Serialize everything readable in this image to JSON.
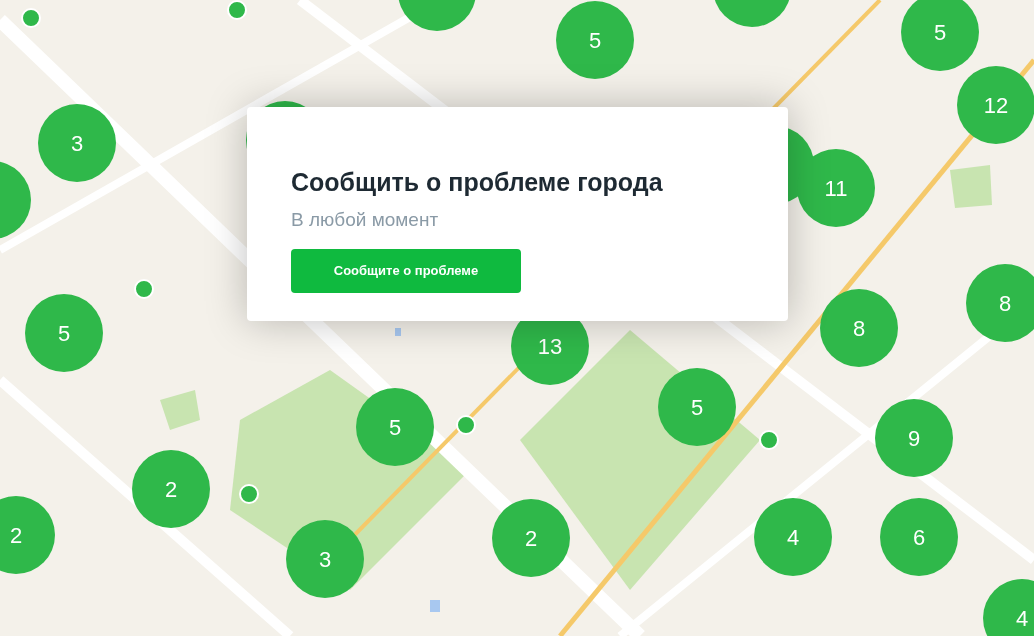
{
  "clusters": [
    {
      "count": "5"
    },
    {
      "count": "5"
    },
    {
      "count": "12"
    },
    {
      "count": "3"
    },
    {
      "count": "11"
    },
    {
      "count": "8"
    },
    {
      "count": "5"
    },
    {
      "count": "13"
    },
    {
      "count": "8"
    },
    {
      "count": "5"
    },
    {
      "count": "5"
    },
    {
      "count": "9"
    },
    {
      "count": "2"
    },
    {
      "count": "2"
    },
    {
      "count": "3"
    },
    {
      "count": "2"
    },
    {
      "count": "4"
    },
    {
      "count": "6"
    },
    {
      "count": "4"
    }
  ],
  "card": {
    "title": "Сообщить о проблеме города",
    "subtitle": "В любой момент",
    "button": "Сообщите о проблеме"
  }
}
